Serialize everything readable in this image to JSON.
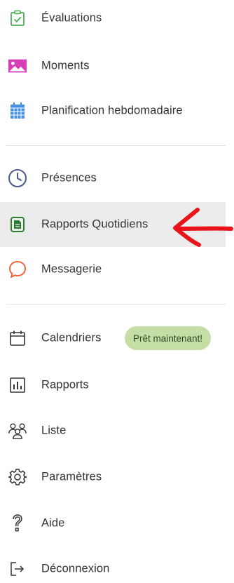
{
  "menu": {
    "items": [
      {
        "label": "Évaluations",
        "icon": "evaluations-icon"
      },
      {
        "label": "Moments",
        "icon": "moments-icon"
      },
      {
        "label": "Planification hebdomadaire",
        "icon": "weekly-planning-icon"
      },
      {
        "label": "Présences",
        "icon": "clock-icon"
      },
      {
        "label": "Rapports Quotidiens",
        "icon": "daily-reports-icon",
        "active": true
      },
      {
        "label": "Messagerie",
        "icon": "messaging-icon"
      },
      {
        "label": "Calendriers",
        "icon": "calendar-icon",
        "badge": "Prêt maintenant!"
      },
      {
        "label": "Rapports",
        "icon": "bar-chart-icon"
      },
      {
        "label": "Liste",
        "icon": "people-icon"
      },
      {
        "label": "Paramètres",
        "icon": "gear-icon"
      },
      {
        "label": "Aide",
        "icon": "help-icon"
      },
      {
        "label": "Déconnexion",
        "icon": "logout-icon"
      }
    ]
  },
  "colors": {
    "evaluations": "#4caf50",
    "moments": "#d63fb8",
    "planning": "#4a90e2",
    "presences": "#4a5a8c",
    "daily_reports": "#2e7d32",
    "messaging": "#f0643c",
    "badge_bg": "#c5dea6",
    "active_bg": "#ececec",
    "annotation_arrow": "#e8141a"
  }
}
